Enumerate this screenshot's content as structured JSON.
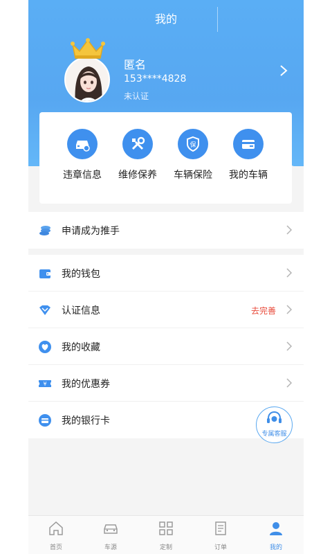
{
  "header": {
    "title": "我的"
  },
  "profile": {
    "name": "匿名",
    "phone": "153****4828",
    "status": "未认证"
  },
  "shortcuts": [
    {
      "label": "违章信息",
      "icon": "car-violation-icon"
    },
    {
      "label": "维修保养",
      "icon": "wrench-tools-icon"
    },
    {
      "label": "车辆保险",
      "icon": "insurance-shield-icon"
    },
    {
      "label": "我的车辆",
      "icon": "vehicle-card-icon"
    }
  ],
  "menu_top": [
    {
      "label": "申请成为推手",
      "icon": "coins-icon"
    }
  ],
  "menu_list": [
    {
      "label": "我的钱包",
      "icon": "wallet-icon"
    },
    {
      "label": "认证信息",
      "icon": "diamond-verify-icon",
      "extra": "去完善"
    },
    {
      "label": "我的收藏",
      "icon": "heart-icon"
    },
    {
      "label": "我的优惠券",
      "icon": "coupon-icon"
    },
    {
      "label": "我的银行卡",
      "icon": "bank-card-icon"
    }
  ],
  "service": {
    "label": "专属客服"
  },
  "tabs": [
    {
      "label": "首页",
      "icon": "home-icon"
    },
    {
      "label": "车源",
      "icon": "car-source-icon"
    },
    {
      "label": "定制",
      "icon": "grid-icon"
    },
    {
      "label": "订单",
      "icon": "order-icon"
    },
    {
      "label": "我的",
      "icon": "user-icon",
      "active": true
    }
  ],
  "colors": {
    "primary": "#3f90ee",
    "header": "#5aaef5",
    "accent_red": "#e84a3a"
  }
}
